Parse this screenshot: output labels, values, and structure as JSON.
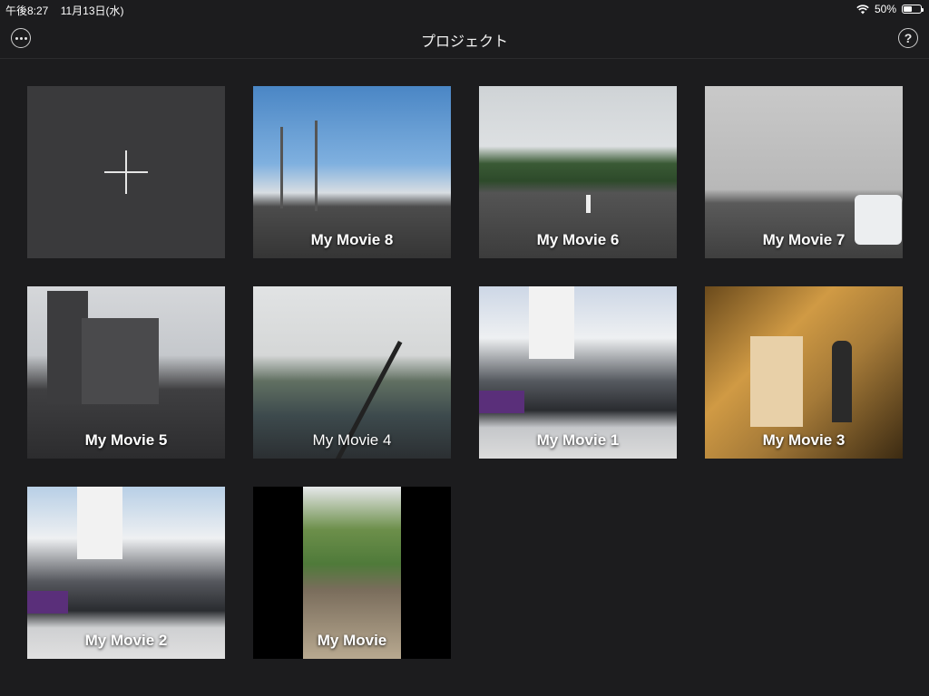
{
  "status_bar": {
    "time": "午後8:27",
    "date": "11月13日(水)",
    "battery_percent": "50%",
    "battery_level": 0.5
  },
  "header": {
    "title": "プロジェクト",
    "more_icon": "ellipsis-circle-icon",
    "help_icon": "question-circle-icon",
    "help_glyph": "?"
  },
  "projects": [
    {
      "title": "My Movie 8"
    },
    {
      "title": "My Movie 6"
    },
    {
      "title": "My Movie 7"
    },
    {
      "title": "My Movie 5"
    },
    {
      "title": "My Movie 4"
    },
    {
      "title": "My Movie 1"
    },
    {
      "title": "My Movie 3"
    },
    {
      "title": "My Movie 2"
    },
    {
      "title": "My Movie"
    }
  ],
  "colors": {
    "background": "#1c1c1e",
    "new_tile": "#3a3a3c",
    "text": "#ffffff"
  }
}
